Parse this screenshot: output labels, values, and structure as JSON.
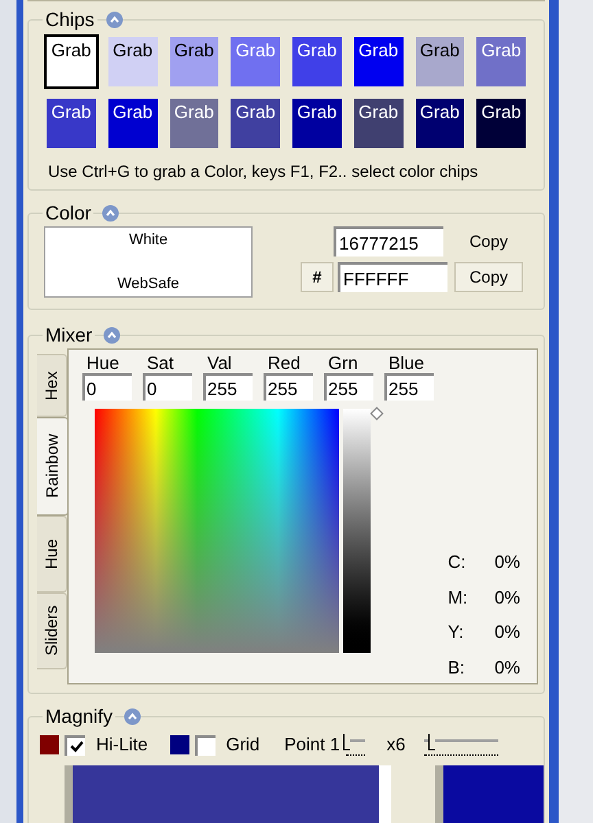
{
  "chips": {
    "title": "Chips",
    "items": [
      {
        "label": "Grab",
        "color": "#ffffff",
        "selected": true
      },
      {
        "label": "Grab",
        "color": "#d0d0f4",
        "selected": false
      },
      {
        "label": "Grab",
        "color": "#a0a0f0",
        "selected": false
      },
      {
        "label": "Grab",
        "color": "#7070f0",
        "selected": false
      },
      {
        "label": "Grab",
        "color": "#4040e8",
        "selected": false
      },
      {
        "label": "Grab",
        "color": "#0000f0",
        "selected": false
      },
      {
        "label": "Grab",
        "color": "#a8a8cc",
        "selected": false
      },
      {
        "label": "Grab",
        "color": "#7070c8",
        "selected": false
      },
      {
        "label": "Grab",
        "color": "#3838c8",
        "selected": false
      },
      {
        "label": "Grab",
        "color": "#0000d0",
        "selected": false
      },
      {
        "label": "Grab",
        "color": "#707098",
        "selected": false
      },
      {
        "label": "Grab",
        "color": "#4040a0",
        "selected": false
      },
      {
        "label": "Grab",
        "color": "#0000a0",
        "selected": false
      },
      {
        "label": "Grab",
        "color": "#404070",
        "selected": false
      },
      {
        "label": "Grab",
        "color": "#000070",
        "selected": false
      },
      {
        "label": "Grab",
        "color": "#000038",
        "selected": false
      }
    ],
    "hint": "Use Ctrl+G to grab a Color, keys F1, F2.. select color chips"
  },
  "color": {
    "title": "Color",
    "name": "White",
    "websafe": "WebSafe",
    "decimal": "16777215",
    "hash": "#",
    "hex": "FFFFFF",
    "copy_buttons": [
      "Copy",
      "Copy"
    ]
  },
  "mixer": {
    "title": "Mixer",
    "tabs": [
      {
        "label": "Hex",
        "selected": false
      },
      {
        "label": "Rainbow",
        "selected": true
      },
      {
        "label": "Hue",
        "selected": false
      },
      {
        "label": "Sliders",
        "selected": false
      }
    ],
    "fields": [
      {
        "label": "Hue",
        "value": "0"
      },
      {
        "label": "Sat",
        "value": "0"
      },
      {
        "label": "Val",
        "value": "255"
      },
      {
        "label": "Red",
        "value": "255"
      },
      {
        "label": "Grn",
        "value": "255"
      },
      {
        "label": "Blue",
        "value": "255"
      }
    ],
    "value_slider": {
      "level": 1
    },
    "cmyk": [
      {
        "label": "C:",
        "value": "0%"
      },
      {
        "label": "M:",
        "value": "0%"
      },
      {
        "label": "Y:",
        "value": "0%"
      },
      {
        "label": "B:",
        "value": "0%"
      }
    ]
  },
  "magnify": {
    "title": "Magnify",
    "hilite": {
      "label": "Hi-Lite",
      "color": "#800000",
      "checked": true
    },
    "grid": {
      "label": "Grid",
      "color": "#000080",
      "checked": false
    },
    "point_label": "Point 1",
    "zoom_label": "x6",
    "zoom_slider": {
      "level": 0.1
    }
  }
}
